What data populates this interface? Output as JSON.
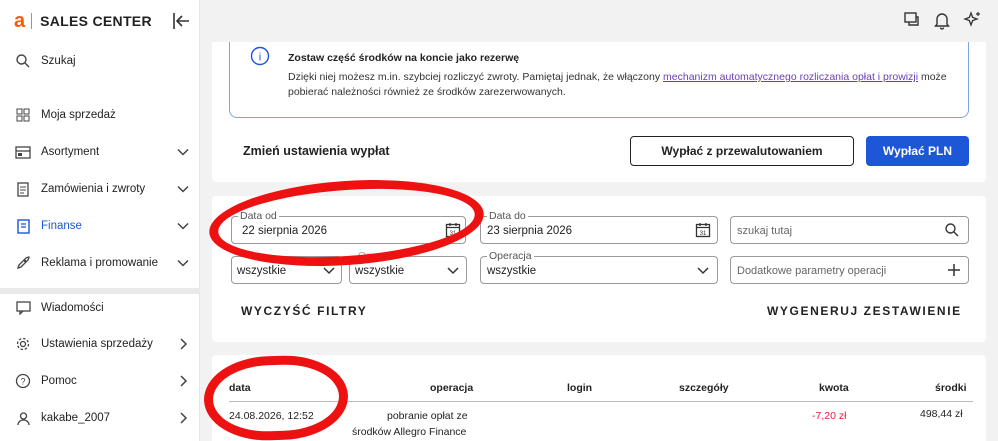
{
  "brand": {
    "logo_letter": "a",
    "name": "SALES CENTER"
  },
  "sidebar": {
    "items": [
      {
        "label": "Szukaj",
        "icon": "search-icon"
      },
      {
        "label": "Moja sprzedaż",
        "icon": "grid-icon"
      },
      {
        "label": "Asortyment",
        "icon": "box-icon"
      },
      {
        "label": "Zamówienia i zwroty",
        "icon": "document-icon"
      },
      {
        "label": "Finanse",
        "icon": "finance-icon",
        "active": true
      },
      {
        "label": "Reklama i promowanie",
        "icon": "rocket-icon"
      },
      {
        "label": "Wiadomości",
        "icon": "message-icon"
      },
      {
        "label": "Ustawienia sprzedaży",
        "icon": "gear-icon"
      },
      {
        "label": "Pomoc",
        "icon": "help-icon"
      },
      {
        "label": "kakabe_2007",
        "icon": "user-icon"
      }
    ]
  },
  "info": {
    "title": "Zostaw część środków na koncie jako rezerwę",
    "body_start": "Dzięki niej możesz m.in. szybciej rozliczyć zwroty. Pamiętaj jednak, że włączony ",
    "link": "mechanizm automatycznego rozliczania opłat i prowizji",
    "body_end": " może pobierać należności również ze środków zarezerwowanych."
  },
  "payout": {
    "title": "Zmień ustawienia wypłat",
    "convert_button": "Wypłać z przewalutowaniem",
    "pln_button": "Wypłać PLN"
  },
  "filters": {
    "date_from_label": "Data od",
    "date_from_value": "22 sierpnia 2026",
    "date_to_label": "Data do",
    "date_to_value": "23 sierpnia 2026",
    "search_placeholder": "szukaj tutaj",
    "select1_value": "wszystkie",
    "select2_label": "Operator",
    "select2_value": "wszystkie",
    "operation_label": "Operacja",
    "operation_value": "wszystkie",
    "extra_params_placeholder": "Dodatkowe parametry operacji",
    "clear_button": "WYCZYŚĆ FILTRY",
    "generate_button": "WYGENERUJ ZESTAWIENIE"
  },
  "table": {
    "headers": [
      "data",
      "operacja",
      "login",
      "szczegóły",
      "kwota",
      "środki"
    ],
    "rows": [
      {
        "date": "24.08.2026, 12:52",
        "operation_line1": "pobranie opłat ze",
        "operation_line2": "środków Allegro Finance",
        "amount": "-7,20 zł",
        "funds": "498,44 zł"
      }
    ]
  },
  "colors": {
    "accent": "#1d56d7",
    "brand": "#ff5a00",
    "negative": "#e01e3c",
    "annotation": "#ee1111"
  }
}
